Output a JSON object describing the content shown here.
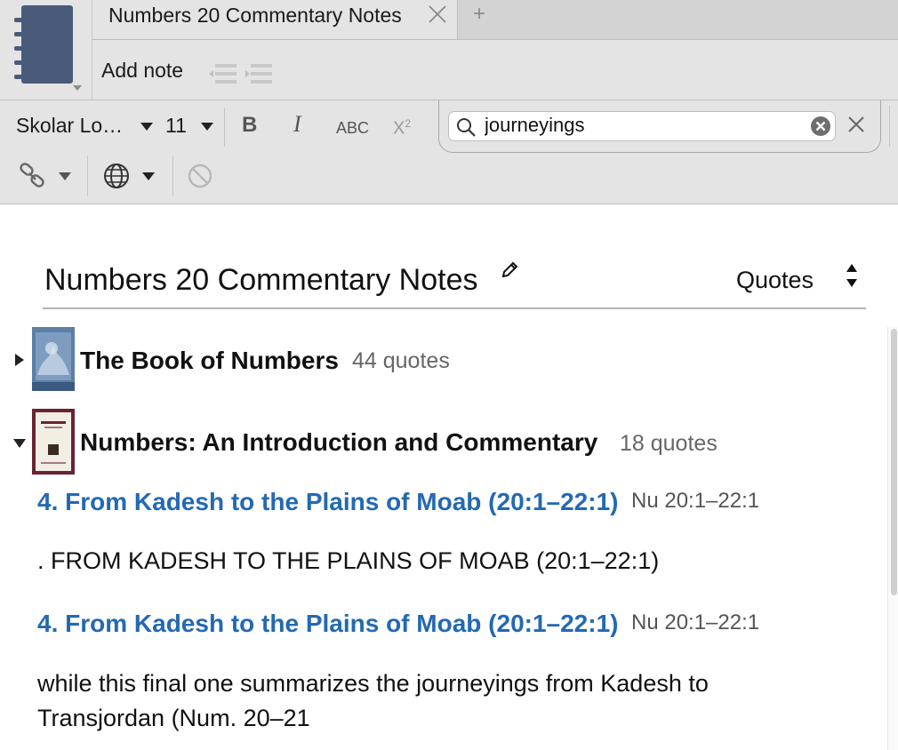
{
  "tab": {
    "title": "Numbers 20 Commentary Notes",
    "add_label": "+"
  },
  "toolbar": {
    "add_note_label": "Add note"
  },
  "format": {
    "font_name": "Skolar Lo…",
    "font_size": "11",
    "bold_label": "B",
    "italic_label": "I",
    "caps_label": "ABC",
    "superscript_base": "X",
    "superscript_mark": "2"
  },
  "search": {
    "value": "journeyings"
  },
  "note": {
    "title": "Numbers 20 Commentary Notes",
    "sort_label": "Quotes"
  },
  "books": [
    {
      "title": "The Book of Numbers",
      "count": "44 quotes",
      "expanded": false
    },
    {
      "title": "Numbers: An Introduction and Commentary",
      "count": "18 quotes",
      "expanded": true
    }
  ],
  "quotes": [
    {
      "heading": "4. From Kadesh to the Plains of Moab (20:1–22:1)",
      "ref": "Nu 20:1–22:1",
      "text": ". FROM KADESH TO THE PLAINS OF MOAB (20:1–22:1)"
    },
    {
      "heading": "4. From Kadesh to the Plains of Moab (20:1–22:1)",
      "ref": "Nu 20:1–22:1",
      "text": "while this final one summarizes the journeyings from Kadesh to Transjordan (Num. 20–21"
    }
  ],
  "colors": {
    "link_blue": "#2369b3",
    "notebook_blue": "#4a5a7a",
    "toolbar_gray": "#e4e4e4"
  },
  "icons": [
    "notebook-icon",
    "close-icon",
    "indent-icon",
    "outdent-icon",
    "search-icon",
    "clear-search-icon",
    "link-icon",
    "globe-icon",
    "ban-icon",
    "pencil-icon",
    "sort-icon"
  ]
}
